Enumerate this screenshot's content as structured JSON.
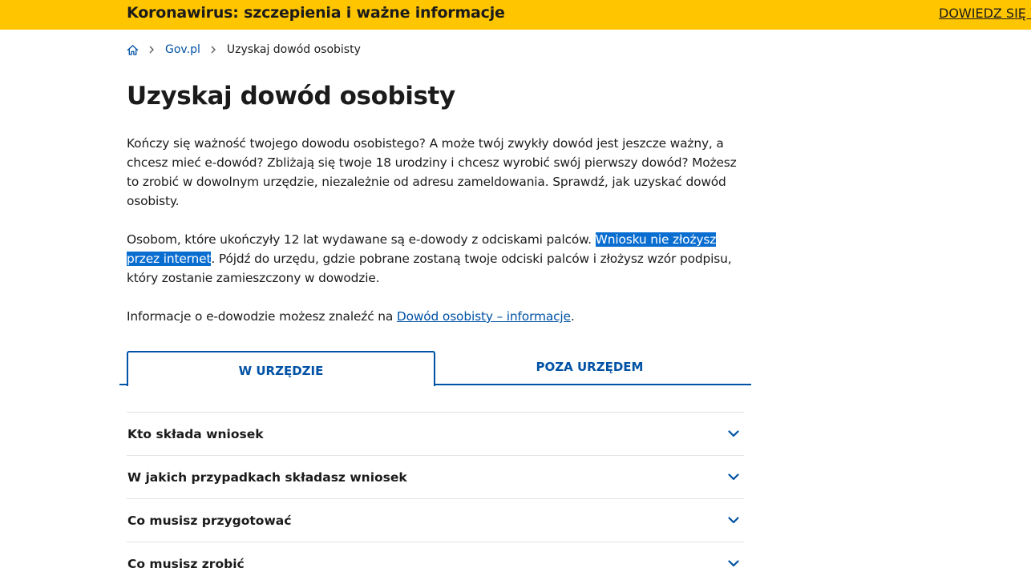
{
  "banner": {
    "title": "Koronawirus: szczepienia i ważne informacje",
    "link": "DOWIEDZ SIĘ WIĘCEJ"
  },
  "breadcrumb": {
    "home_icon": "home-icon",
    "items": [
      {
        "label": "Gov.pl"
      },
      {
        "label": "Uzyskaj dowód osobisty"
      }
    ]
  },
  "page": {
    "title": "Uzyskaj dowód osobisty",
    "intro": "Kończy się ważność twojego dowodu osobistego? A może twój zwykły dowód jest jeszcze ważny, a chcesz mieć e-dowód? Zbliżają się twoje 18 urodziny i chcesz wyrobić swój pierwszy dowód? Możesz to zrobić w dowolnym urzędzie, niezależnie od adresu zameldowania. Sprawdź, jak uzyskać dowód osobisty.",
    "para2_before": "Osobom, które ukończyły 12 lat wydawane są e-dowody z odciskami palców. ",
    "para2_highlight": "Wniosku nie złożysz przez internet",
    "para2_after": ". Pójdź do urzędu, gdzie pobrane zostaną twoje odciski palców i złożysz wzór podpisu, który zostanie zamieszczony w dowodzie.",
    "para3_before": "Informacje o e-dowodzie możesz znaleźć na ",
    "para3_link": "Dowód osobisty – informacje",
    "para3_after": "."
  },
  "tabs": [
    {
      "label": "W URZĘDZIE",
      "active": true
    },
    {
      "label": "POZA URZĘDEM",
      "active": false
    }
  ],
  "accordion": [
    {
      "label": "Kto składa wniosek"
    },
    {
      "label": "W jakich przypadkach składasz wniosek"
    },
    {
      "label": "Co musisz przygotować"
    },
    {
      "label": "Co musisz zrobić"
    }
  ],
  "colors": {
    "banner_bg": "#ffc600",
    "link": "#0052a5",
    "selection": "#0a6ed1",
    "text": "#1b1b1b"
  }
}
